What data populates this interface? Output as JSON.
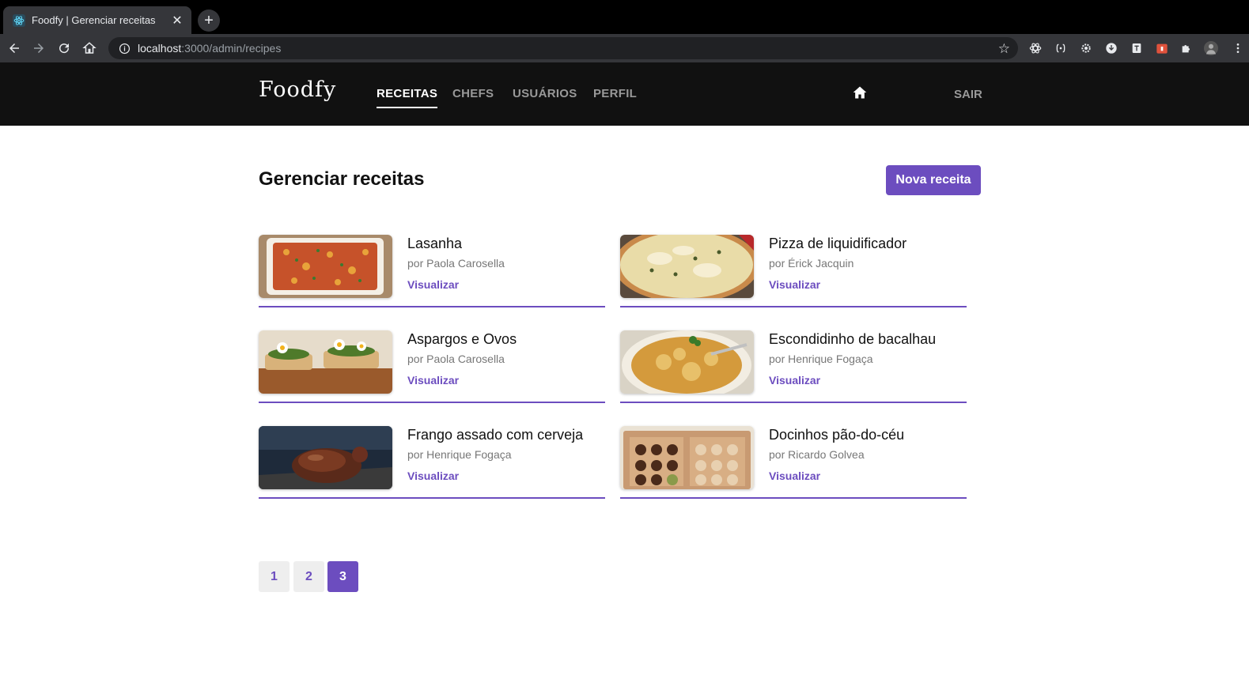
{
  "browser": {
    "tab_title": "Foodfy | Gerenciar receitas",
    "close_glyph": "✕",
    "new_tab_glyph": "+",
    "url_host": "localhost",
    "url_path": ":3000/admin/recipes",
    "star_glyph": "☆"
  },
  "header": {
    "logo": "Foodfy",
    "nav": [
      {
        "label": "RECEITAS",
        "active": true
      },
      {
        "label": "CHEFS",
        "active": false
      },
      {
        "label": "USUÁRIOS",
        "active": false
      },
      {
        "label": "PERFIL",
        "active": false
      }
    ],
    "logout": "SAIR"
  },
  "main": {
    "title": "Gerenciar receitas",
    "new_button": "Nova receita",
    "view_label": "Visualizar"
  },
  "recipes": [
    {
      "name": "Lasanha",
      "author": "por Paola Carosella"
    },
    {
      "name": "Pizza de liquidificador",
      "author": "por Érick Jacquin"
    },
    {
      "name": "Aspargos e Ovos",
      "author": "por Paola Carosella"
    },
    {
      "name": "Escondidinho de bacalhau",
      "author": "por Henrique Fogaça"
    },
    {
      "name": "Frango assado com cerveja",
      "author": "por Henrique Fogaça"
    },
    {
      "name": "Docinhos pão-do-céu",
      "author": "por Ricardo Golvea"
    }
  ],
  "pagination": {
    "pages": [
      "1",
      "2",
      "3"
    ],
    "current": "3"
  },
  "colors": {
    "accent": "#6c4dbf",
    "header_bg": "#111111"
  }
}
